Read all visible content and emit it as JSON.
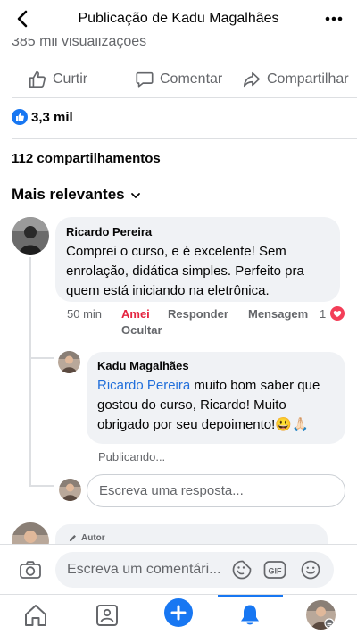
{
  "header": {
    "title": "Publicação de Kadu Magalhães"
  },
  "post": {
    "views": "385 mil visualizações",
    "actions": {
      "like": "Curtir",
      "comment": "Comentar",
      "share": "Compartilhar"
    },
    "reactions_count": "3,3 mil",
    "shares_count": "112 compartilhamentos"
  },
  "comments_section": {
    "sort_label": "Mais relevantes"
  },
  "comment": {
    "author": "Ricardo Pereira",
    "text": "Comprei o curso, e é excelente! Sem enrolação, didática simples. Perfeito pra quem está iniciando na eletrônica.",
    "time": "50 min",
    "loved_label": "Amei",
    "reply_label": "Responder",
    "message_label": "Mensagem",
    "reaction_count": "1",
    "hide_label": "Ocultar"
  },
  "reply": {
    "author": "Kadu Magalhães",
    "mention": "Ricardo Pereira",
    "text": " muito bom saber que gostou do curso, Ricardo! Muito obrigado por seu depoimento!😃🙏🏻",
    "status": "Publicando..."
  },
  "reply_input": {
    "placeholder": "Escreva uma resposta..."
  },
  "next_comment": {
    "badge": "Autor"
  },
  "composer": {
    "placeholder": "Escreva um comentári..."
  },
  "colors": {
    "accent": "#1877f2",
    "loved": "#e4243f",
    "mention": "#216fdb",
    "bubble": "#f0f2f5"
  }
}
